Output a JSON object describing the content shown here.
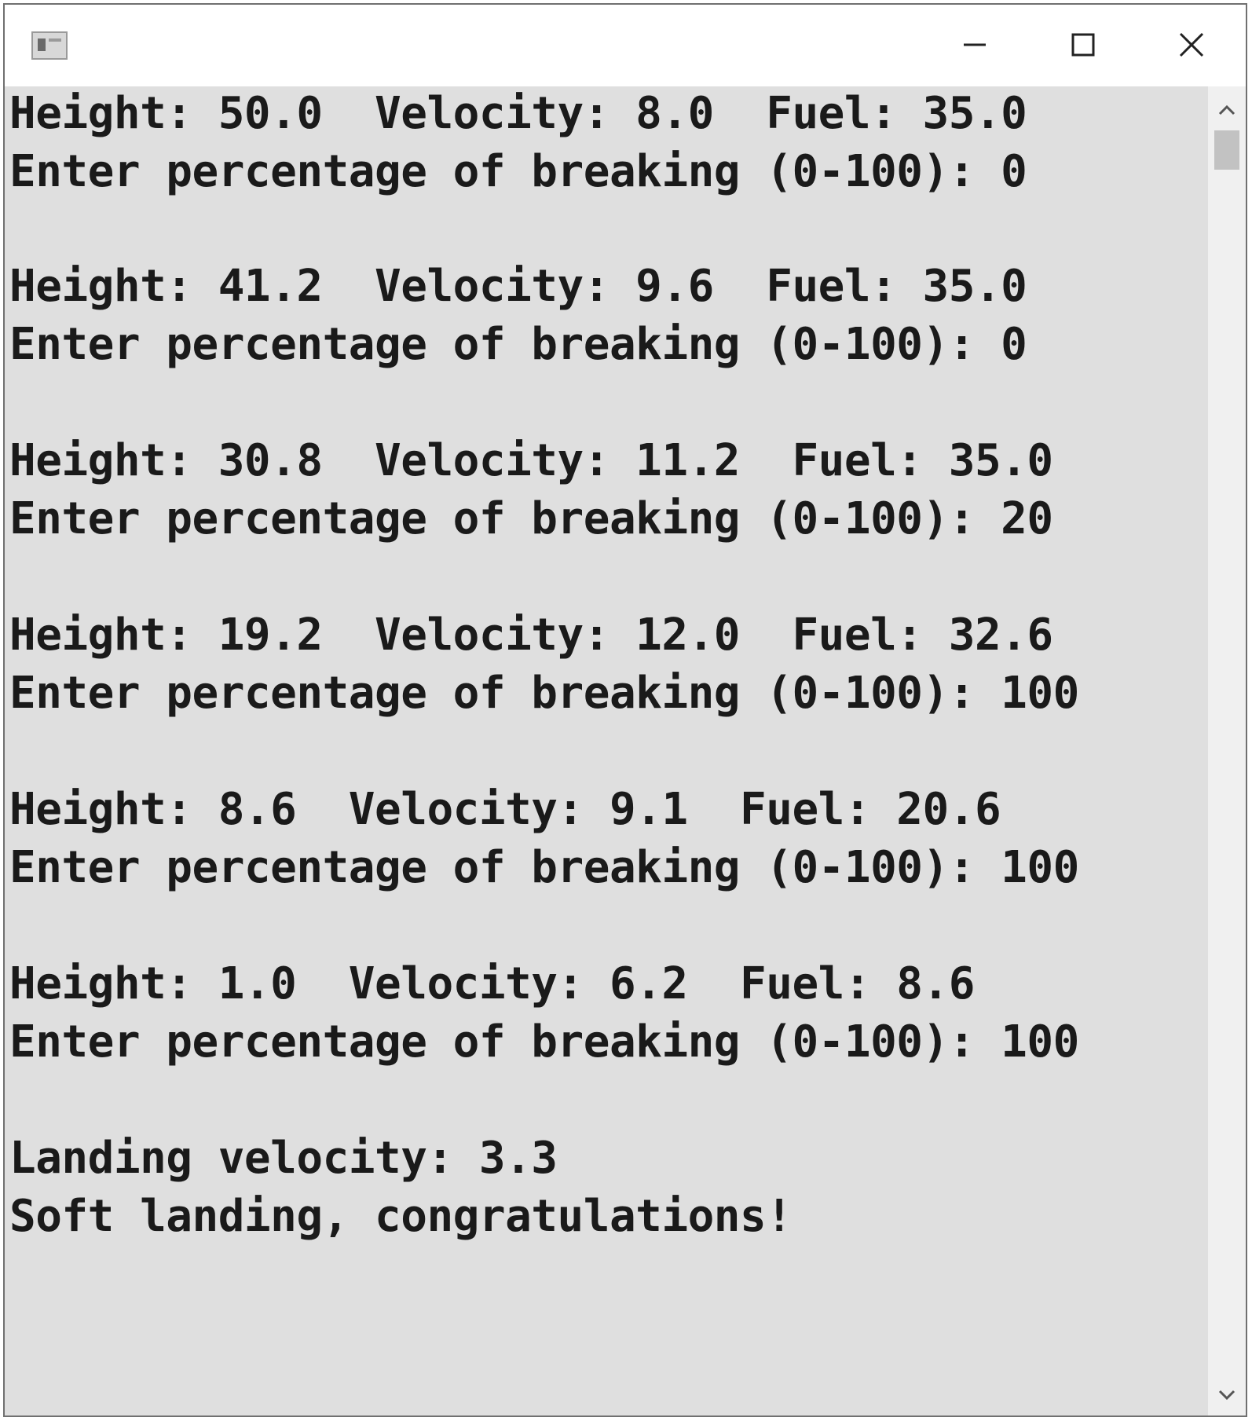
{
  "window": {
    "controls": {
      "minimize_icon": "minimize-icon",
      "maximize_icon": "maximize-icon",
      "close_icon": "close-icon"
    }
  },
  "console": {
    "lines": [
      "Height: 50.0  Velocity: 8.0  Fuel: 35.0",
      "Enter percentage of breaking (0-100): 0",
      "Height: 41.2  Velocity: 9.6  Fuel: 35.0",
      "Enter percentage of breaking (0-100): 0",
      "Height: 30.8  Velocity: 11.2  Fuel: 35.0",
      "Enter percentage of breaking (0-100): 20",
      "Height: 19.2  Velocity: 12.0  Fuel: 32.6",
      "Enter percentage of breaking (0-100): 100",
      "Height: 8.6  Velocity: 9.1  Fuel: 20.6",
      "Enter percentage of breaking (0-100): 100",
      "Height: 1.0  Velocity: 6.2  Fuel: 8.6",
      "Enter percentage of breaking (0-100): 100",
      "Landing velocity: 3.3",
      "Soft landing, congratulations!"
    ]
  },
  "colors": {
    "console_bg": "#dfdfdf",
    "text": "#1a1a1a",
    "scrollbar_bg": "#f0f0f0",
    "thumb": "#c2c2c2"
  }
}
